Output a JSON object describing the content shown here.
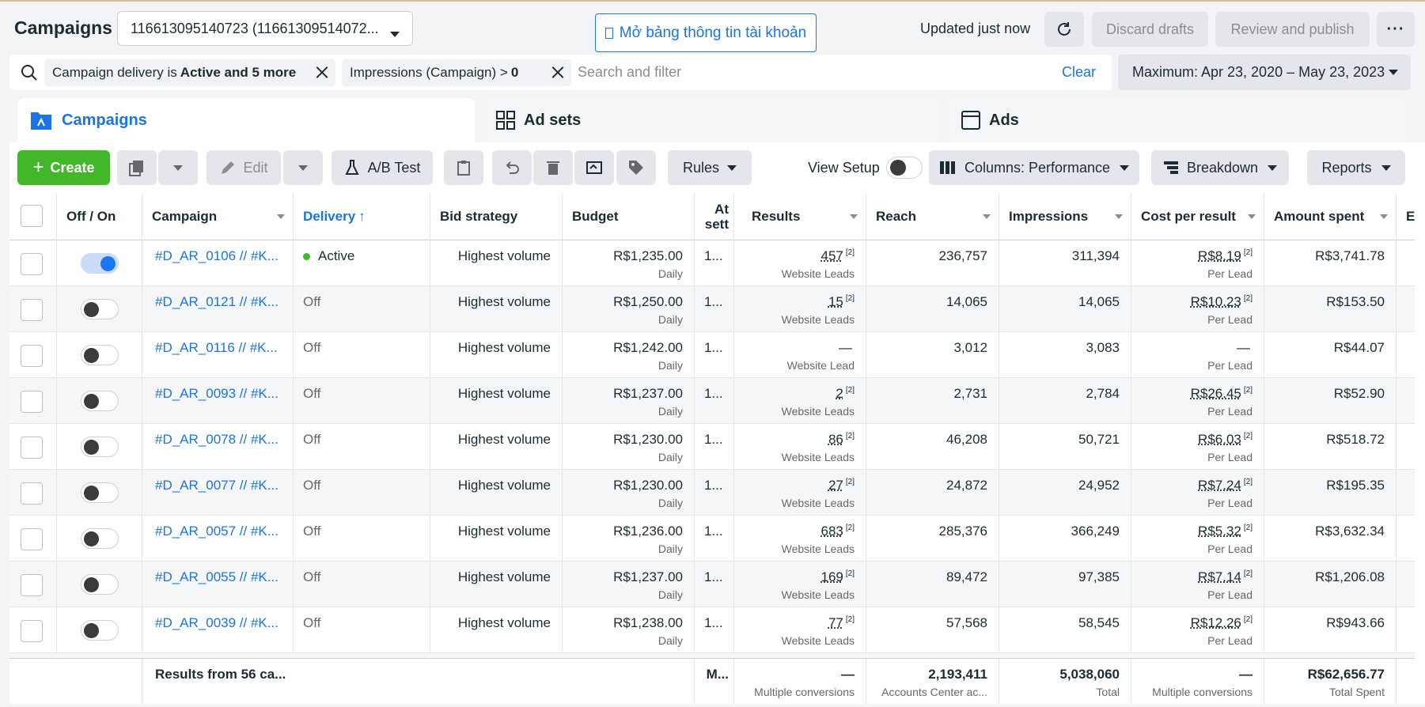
{
  "header": {
    "title": "Campaigns",
    "account": "116613095140723 (11661309514072...",
    "info_button": "Mở bảng thông tin tài khoản",
    "updated": "Updated just now",
    "discard": "Discard drafts",
    "review": "Review and publish"
  },
  "filters": {
    "chip1_text": "Campaign delivery is",
    "chip1_bold": "Active and 5 more",
    "chip2_text": "Impressions (Campaign) >",
    "chip2_bold": "0",
    "placeholder": "Search and filter",
    "clear": "Clear",
    "date": "Maximum: Apr 23, 2020 – May 23, 2023"
  },
  "tabs": [
    {
      "label": "Campaigns"
    },
    {
      "label": "Ad sets"
    },
    {
      "label": "Ads"
    }
  ],
  "toolbar": {
    "create": "Create",
    "edit": "Edit",
    "ab_test": "A/B Test",
    "rules": "Rules",
    "view_setup": "View Setup",
    "columns": "Columns: Performance",
    "breakdown": "Breakdown",
    "reports": "Reports"
  },
  "columns": {
    "offon": "Off / On",
    "campaign": "Campaign",
    "delivery": "Delivery",
    "bid": "Bid strategy",
    "budget": "Budget",
    "attr_1": "At",
    "attr_2": "sett",
    "results": "Results",
    "reach": "Reach",
    "impressions": "Impressions",
    "cpr": "Cost per result",
    "spent": "Amount spent",
    "extra": "E"
  },
  "rows": [
    {
      "name": "#D_AR_0106 // #K...",
      "on": true,
      "delivery": "Active",
      "bid": "Highest volume",
      "budget": "R$1,235.00",
      "budget_type": "Daily",
      "attr": "1...",
      "results": "457",
      "sup": "[2]",
      "result_type": "Website Leads",
      "reach": "236,757",
      "impressions": "311,394",
      "cpr": "R$8.19",
      "cpr_type": "Per Lead",
      "spent": "R$3,741.78"
    },
    {
      "name": "#D_AR_0121 // #K...",
      "on": false,
      "delivery": "Off",
      "bid": "Highest volume",
      "budget": "R$1,250.00",
      "budget_type": "Daily",
      "attr": "1...",
      "results": "15",
      "sup": "[2]",
      "result_type": "Website Leads",
      "reach": "14,065",
      "impressions": "14,065",
      "cpr": "R$10.23",
      "cpr_type": "Per Lead",
      "spent": "R$153.50"
    },
    {
      "name": "#D_AR_0116 // #K...",
      "on": false,
      "delivery": "Off",
      "bid": "Highest volume",
      "budget": "R$1,242.00",
      "budget_type": "Daily",
      "attr": "1...",
      "results": "—",
      "sup": "",
      "result_type": "Website Lead",
      "reach": "3,012",
      "impressions": "3,083",
      "cpr": "—",
      "cpr_type": "Per Lead",
      "spent": "R$44.07"
    },
    {
      "name": "#D_AR_0093 // #K...",
      "on": false,
      "delivery": "Off",
      "bid": "Highest volume",
      "budget": "R$1,237.00",
      "budget_type": "Daily",
      "attr": "1...",
      "results": "2",
      "sup": "[2]",
      "result_type": "Website Leads",
      "reach": "2,731",
      "impressions": "2,784",
      "cpr": "R$26.45",
      "cpr_type": "Per Lead",
      "spent": "R$52.90"
    },
    {
      "name": "#D_AR_0078 // #K...",
      "on": false,
      "delivery": "Off",
      "bid": "Highest volume",
      "budget": "R$1,230.00",
      "budget_type": "Daily",
      "attr": "1...",
      "results": "86",
      "sup": "[2]",
      "result_type": "Website Leads",
      "reach": "46,208",
      "impressions": "50,721",
      "cpr": "R$6.03",
      "cpr_type": "Per Lead",
      "spent": "R$518.72"
    },
    {
      "name": "#D_AR_0077 // #K...",
      "on": false,
      "delivery": "Off",
      "bid": "Highest volume",
      "budget": "R$1,230.00",
      "budget_type": "Daily",
      "attr": "1...",
      "results": "27",
      "sup": "[2]",
      "result_type": "Website Leads",
      "reach": "24,872",
      "impressions": "24,952",
      "cpr": "R$7.24",
      "cpr_type": "Per Lead",
      "spent": "R$195.35"
    },
    {
      "name": "#D_AR_0057 // #K...",
      "on": false,
      "delivery": "Off",
      "bid": "Highest volume",
      "budget": "R$1,236.00",
      "budget_type": "Daily",
      "attr": "1...",
      "results": "683",
      "sup": "[2]",
      "result_type": "Website Leads",
      "reach": "285,376",
      "impressions": "366,249",
      "cpr": "R$5.32",
      "cpr_type": "Per Lead",
      "spent": "R$3,632.34"
    },
    {
      "name": "#D_AR_0055 // #K...",
      "on": false,
      "delivery": "Off",
      "bid": "Highest volume",
      "budget": "R$1,237.00",
      "budget_type": "Daily",
      "attr": "1...",
      "results": "169",
      "sup": "[2]",
      "result_type": "Website Leads",
      "reach": "89,472",
      "impressions": "97,385",
      "cpr": "R$7.14",
      "cpr_type": "Per Lead",
      "spent": "R$1,206.08"
    },
    {
      "name": "#D_AR_0039 // #K...",
      "on": false,
      "delivery": "Off",
      "bid": "Highest volume",
      "budget": "R$1,238.00",
      "budget_type": "Daily",
      "attr": "1...",
      "results": "77",
      "sup": "[2]",
      "result_type": "Website Leads",
      "reach": "57,568",
      "impressions": "58,545",
      "cpr": "R$12.26",
      "cpr_type": "Per Lead",
      "spent": "R$943.66"
    }
  ],
  "footer": {
    "label": "Results from 56 ca...",
    "attr": "M...",
    "results": "—",
    "results_sub": "Multiple conversions",
    "reach": "2,193,411",
    "reach_sub": "Accounts Center ac...",
    "impressions": "5,038,060",
    "impressions_sub": "Total",
    "cpr": "—",
    "cpr_sub": "Multiple conversions",
    "spent": "R$62,656.77",
    "spent_sub": "Total Spent"
  },
  "colors": {
    "accent": "#1b74e4",
    "create": "#42b72a",
    "active_dot": "#42b72a"
  }
}
